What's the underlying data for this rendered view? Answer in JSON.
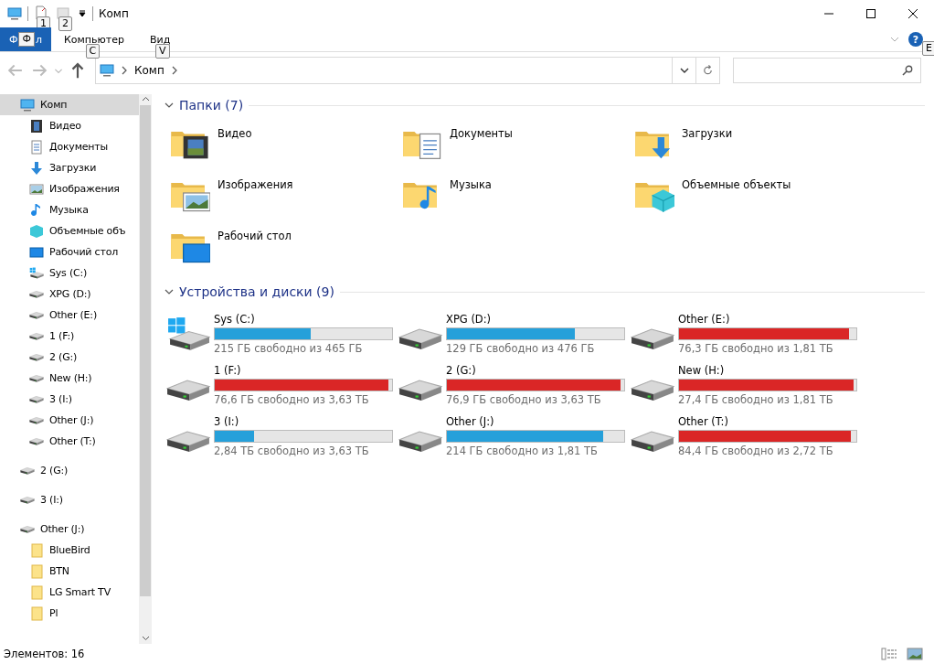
{
  "window": {
    "title": "Комп",
    "quick_access": [
      {
        "keytip": "1"
      },
      {
        "keytip": "2"
      }
    ]
  },
  "ribbon": {
    "tabs": [
      {
        "kind": "file",
        "label_start": "Ф",
        "keytip": "Ф",
        "label_end": "л"
      },
      {
        "kind": "tab",
        "label": "Компьютер",
        "keytip": "C"
      },
      {
        "kind": "tab",
        "label": "Вид",
        "keytip": "V"
      }
    ],
    "help_label": "?",
    "help_keytip": "E"
  },
  "address": {
    "path": [
      "Комп"
    ]
  },
  "sidebar": {
    "items": [
      {
        "label": "Комп",
        "kind": "computer",
        "selected": true,
        "children": [
          {
            "label": "Видео",
            "kind": "video",
            "selected": false
          },
          {
            "label": "Документы",
            "kind": "documents",
            "selected": false
          },
          {
            "label": "Загрузки",
            "kind": "downloads",
            "selected": false
          },
          {
            "label": "Изображения",
            "kind": "pictures",
            "selected": false
          },
          {
            "label": "Музыка",
            "kind": "music",
            "selected": false
          },
          {
            "label": "Объемные объ",
            "kind": "objects",
            "selected": false
          },
          {
            "label": "Рабочий стол",
            "kind": "desktop",
            "selected": false
          },
          {
            "label": "Sys (C:)",
            "kind": "system-drive",
            "selected": false
          },
          {
            "label": "XPG (D:)",
            "kind": "drive",
            "selected": false
          },
          {
            "label": "Other (E:)",
            "kind": "drive",
            "selected": false
          },
          {
            "label": "1 (F:)",
            "kind": "drive",
            "selected": false
          },
          {
            "label": "2 (G:)",
            "kind": "drive",
            "selected": false
          },
          {
            "label": "New (H:)",
            "kind": "drive",
            "selected": false
          },
          {
            "label": "3 (I:)",
            "kind": "drive",
            "selected": false
          },
          {
            "label": "Other (J:)",
            "kind": "drive",
            "selected": false
          },
          {
            "label": "Other (T:)",
            "kind": "drive",
            "selected": false
          }
        ]
      },
      {
        "label": "2 (G:)",
        "kind": "drive",
        "selected": false
      },
      {
        "label": "3 (I:)",
        "kind": "drive",
        "selected": false
      },
      {
        "label": "Other (J:)",
        "kind": "drive",
        "selected": false,
        "children": [
          {
            "label": "BlueBird",
            "kind": "folder",
            "selected": false
          },
          {
            "label": "BTN",
            "kind": "folder",
            "selected": false
          },
          {
            "label": "LG Smart TV",
            "kind": "folder",
            "selected": false
          },
          {
            "label": "Pl",
            "kind": "folder",
            "selected": false
          }
        ]
      }
    ]
  },
  "folders": {
    "title": "Папки (7)",
    "expanded": true,
    "items": [
      {
        "label": "Видео",
        "kind": "video"
      },
      {
        "label": "Документы",
        "kind": "documents"
      },
      {
        "label": "Загрузки",
        "kind": "downloads"
      },
      {
        "label": "Изображения",
        "kind": "pictures"
      },
      {
        "label": "Музыка",
        "kind": "music"
      },
      {
        "label": "Объемные объекты",
        "kind": "objects"
      },
      {
        "label": "Рабочий стол",
        "kind": "desktop"
      }
    ]
  },
  "drives": {
    "title": "Устройства и диски (9)",
    "expanded": true,
    "items": [
      {
        "label": "Sys (C:)",
        "system": true,
        "level": 0.54,
        "color": "#26a0da",
        "free": "215 ГБ свободно из 465 ГБ"
      },
      {
        "label": "XPG (D:)",
        "system": false,
        "level": 0.72,
        "color": "#26a0da",
        "free": "129 ГБ свободно из 476 ГБ"
      },
      {
        "label": "Other (E:)",
        "system": false,
        "level": 0.96,
        "color": "#da2626",
        "free": "76,3 ГБ свободно из 1,81 ТБ"
      },
      {
        "label": "1 (F:)",
        "system": false,
        "level": 0.98,
        "color": "#da2626",
        "free": "76,6 ГБ свободно из 3,63 ТБ"
      },
      {
        "label": "2 (G:)",
        "system": false,
        "level": 0.98,
        "color": "#da2626",
        "free": "76,9 ГБ свободно из 3,63 ТБ"
      },
      {
        "label": "New (H:)",
        "system": false,
        "level": 0.985,
        "color": "#da2626",
        "free": "27,4 ГБ свободно из 1,81 ТБ"
      },
      {
        "label": "3 (I:)",
        "system": false,
        "level": 0.22,
        "color": "#26a0da",
        "free": "2,84 ТБ свободно из 3,63 ТБ"
      },
      {
        "label": "Other (J:)",
        "system": false,
        "level": 0.88,
        "color": "#26a0da",
        "free": "214 ГБ свободно из 1,81 ТБ"
      },
      {
        "label": "Other (T:)",
        "system": false,
        "level": 0.97,
        "color": "#da2626",
        "free": "84,4 ГБ свободно из 2,72 ТБ"
      }
    ]
  },
  "status_bar": {
    "text": "Элементов: 16"
  }
}
